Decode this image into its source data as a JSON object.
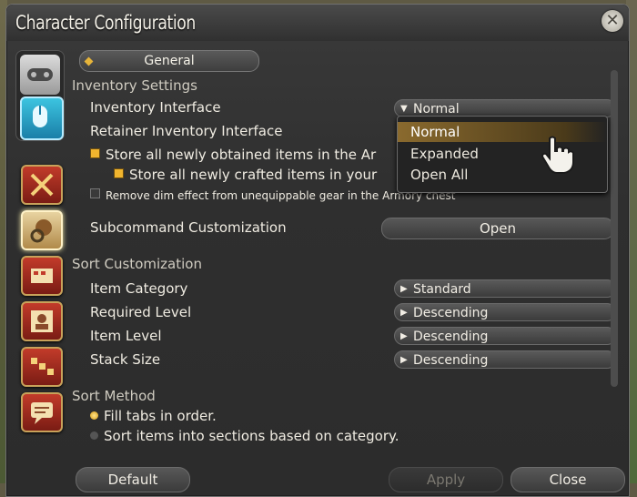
{
  "window": {
    "title": "Character Configuration"
  },
  "tabs": {
    "general": "General"
  },
  "inventory": {
    "heading": "Inventory Settings",
    "interface_label": "Inventory Interface",
    "interface_value": "Normal",
    "retainer_label": "Retainer Inventory Interface",
    "store_obtained": "Store all newly obtained items in the Ar",
    "store_crafted": "Store all newly crafted items in your",
    "remove_dim": "Remove dim effect from unequippable gear in the Armory chest",
    "subcommand_label": "Subcommand Customization",
    "subcommand_button": "Open"
  },
  "dropdown_options": [
    "Normal",
    "Expanded",
    "Open All"
  ],
  "sort": {
    "heading": "Sort Customization",
    "rows": [
      {
        "label": "Item Category",
        "value": "Standard"
      },
      {
        "label": "Required Level",
        "value": "Descending"
      },
      {
        "label": "Item Level",
        "value": "Descending"
      },
      {
        "label": "Stack Size",
        "value": "Descending"
      }
    ]
  },
  "sort_method": {
    "heading": "Sort Method",
    "options": [
      "Fill tabs in order.",
      "Sort items into sections based on category."
    ],
    "selected": 0
  },
  "buttons": {
    "default": "Default",
    "apply": "Apply",
    "close": "Close"
  },
  "icons": [
    "gamepad-icon",
    "mouse-icon",
    "swords-icon",
    "gear-bag-icon",
    "hotbar-icon",
    "nameplate-icon",
    "character-icon",
    "party-icon",
    "chat-icon"
  ],
  "colors": {
    "accent": "#f1b52e",
    "rail": "#c23b2a"
  }
}
